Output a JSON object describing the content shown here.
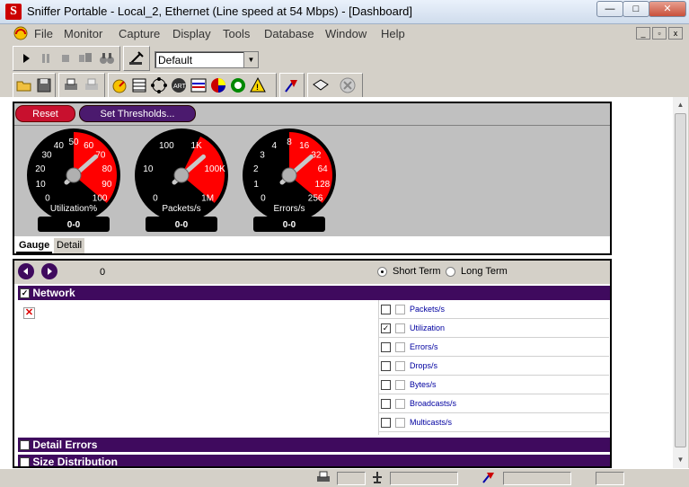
{
  "window": {
    "title": "Sniffer Portable - Local_2, Ethernet (Line speed at 54 Mbps) - [Dashboard]",
    "icon_letter": "S",
    "min": "—",
    "max": "□",
    "close": "✕"
  },
  "menu": [
    "File",
    "Monitor",
    "Capture",
    "Display",
    "Tools",
    "Database",
    "Window",
    "Help"
  ],
  "mdi": {
    "min": "_",
    "restore": "▫",
    "close": "x"
  },
  "toolbar": {
    "profile_value": "Default",
    "profile_arrow": "▼"
  },
  "buttons": {
    "reset": "Reset",
    "set_thresholds": "Set Thresholds..."
  },
  "gauges": [
    {
      "name": "utilization-gauge",
      "label": "Utilization%",
      "ticks": [
        "0",
        "10",
        "20",
        "30",
        "40",
        "50",
        "60",
        "70",
        "80",
        "90",
        "100"
      ],
      "value_display": "0-0",
      "red_from_tick": 5
    },
    {
      "name": "packets-gauge",
      "label": "Packets/s",
      "ticks": [
        "0",
        "10",
        "100",
        "1K",
        "100K",
        "1M"
      ],
      "value_display": "0-0",
      "red_from_tick": 3
    },
    {
      "name": "errors-gauge",
      "label": "Errors/s",
      "ticks": [
        "0",
        "1",
        "2",
        "3",
        "4",
        "8",
        "16",
        "32",
        "64",
        "128",
        "256"
      ],
      "value_display": "0-0",
      "red_from_tick": 5
    }
  ],
  "gauge_tabs": [
    "Gauge",
    "Detail"
  ],
  "detail": {
    "counter": "0",
    "short_term": "Short Term",
    "long_term": "Long Term",
    "sections": [
      {
        "label": "Network"
      },
      {
        "label": "Detail Errors"
      },
      {
        "label": "Size Distribution"
      }
    ],
    "stats": [
      {
        "label": "Packets/s",
        "checked": false
      },
      {
        "label": "Utilization",
        "checked": true
      },
      {
        "label": "Errors/s",
        "checked": false
      },
      {
        "label": "Drops/s",
        "checked": false
      },
      {
        "label": "Bytes/s",
        "checked": false
      },
      {
        "label": "Broadcasts/s",
        "checked": false
      },
      {
        "label": "Multicasts/s",
        "checked": false
      }
    ],
    "error_marker": "✕"
  },
  "colors": {
    "gauge_red": "#ff0000",
    "section_purple": "#3f0a5e",
    "reset_red": "#c8102e"
  }
}
